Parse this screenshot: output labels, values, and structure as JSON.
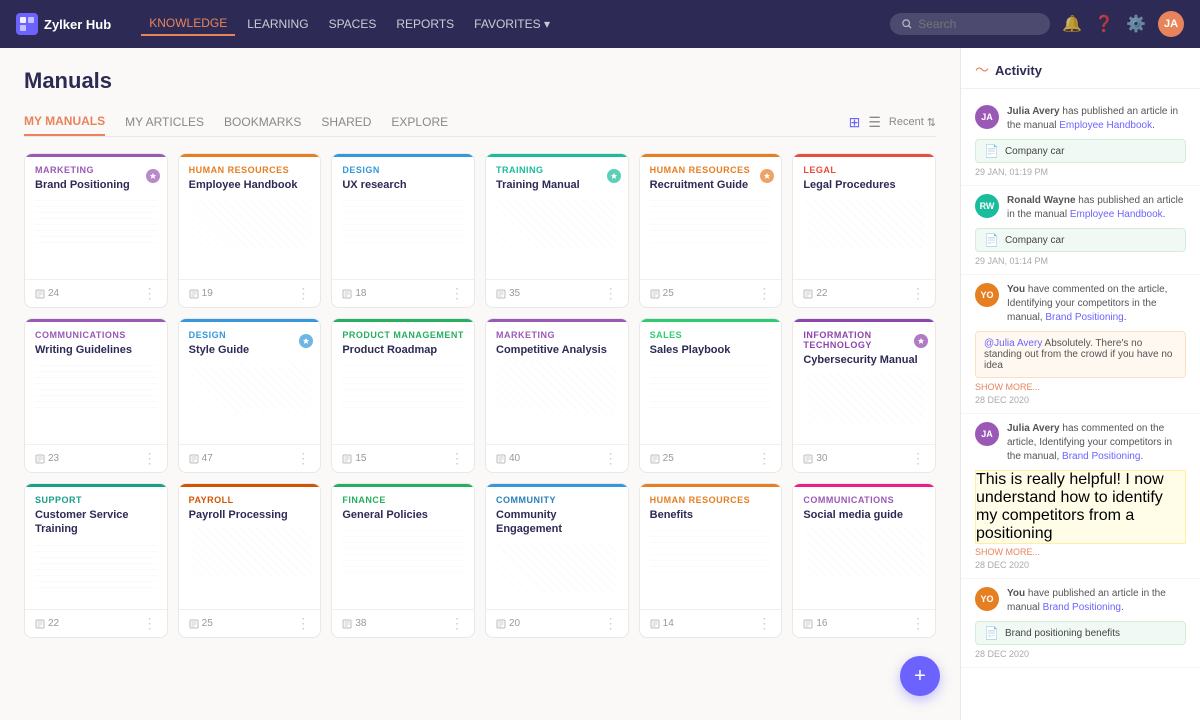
{
  "app": {
    "name": "Zylker Hub",
    "logo_text": "Z"
  },
  "navbar": {
    "items": [
      {
        "label": "KNOWLEDGE",
        "active": true
      },
      {
        "label": "LEARNING",
        "active": false
      },
      {
        "label": "SPACES",
        "active": false
      },
      {
        "label": "REPORTS",
        "active": false
      },
      {
        "label": "FAVORITES ▾",
        "active": false
      }
    ],
    "search_placeholder": "Search",
    "avatar_initials": "JA"
  },
  "page": {
    "title": "Manuals"
  },
  "tabs": [
    {
      "label": "MY MANUALS",
      "active": true
    },
    {
      "label": "MY ARTICLES",
      "active": false
    },
    {
      "label": "BOOKMARKS",
      "active": false
    },
    {
      "label": "SHARED",
      "active": false
    },
    {
      "label": "EXPLORE",
      "active": false
    }
  ],
  "tab_actions": {
    "recent_label": "Recent"
  },
  "cards": [
    {
      "id": 1,
      "category": "MARKETING",
      "cat_class": "cat-marketing",
      "border_class": "border-purple",
      "title": "Brand Positioning",
      "pages": 24,
      "has_badge": true,
      "badge_color": "#9b59b6"
    },
    {
      "id": 2,
      "category": "HUMAN RESOURCES",
      "cat_class": "cat-hr",
      "border_class": "border-orange",
      "title": "Employee Handbook",
      "pages": 19,
      "has_badge": false
    },
    {
      "id": 3,
      "category": "DESIGN",
      "cat_class": "cat-design",
      "border_class": "border-blue",
      "title": "UX research",
      "pages": 18,
      "has_badge": false
    },
    {
      "id": 4,
      "category": "TRAINING",
      "cat_class": "cat-teal",
      "border_class": "border-teal",
      "title": "Training Manual",
      "pages": 35,
      "has_badge": true
    },
    {
      "id": 5,
      "category": "HUMAN RESOURCES",
      "cat_class": "cat-hr",
      "border_class": "border-orange",
      "title": "Recruitment Guide",
      "pages": 25,
      "has_badge": true
    },
    {
      "id": 6,
      "category": "LEGAL",
      "cat_class": "cat-legal",
      "border_class": "border-red",
      "title": "Legal Procedures",
      "pages": 22,
      "has_badge": false
    },
    {
      "id": 7,
      "category": "COMMUNICATIONS",
      "cat_class": "cat-communications",
      "border_class": "border-purple",
      "title": "Writing Guidelines",
      "pages": 23,
      "has_badge": false
    },
    {
      "id": 8,
      "category": "DESIGN",
      "cat_class": "cat-design",
      "border_class": "border-blue",
      "title": "Style Guide",
      "pages": 47,
      "has_badge": true
    },
    {
      "id": 9,
      "category": "PRODUCT MANAGEMENT",
      "cat_class": "cat-product",
      "border_class": "border-green",
      "title": "Product Roadmap",
      "pages": 15,
      "has_badge": false
    },
    {
      "id": 10,
      "category": "MARKETING",
      "cat_class": "cat-marketing",
      "border_class": "border-purple",
      "title": "Competitive Analysis",
      "pages": 40,
      "has_badge": false
    },
    {
      "id": 11,
      "category": "SALES",
      "cat_class": "cat-sales",
      "border_class": "border-darkgreen",
      "title": "Sales Playbook",
      "pages": 25,
      "has_badge": false
    },
    {
      "id": 12,
      "category": "INFORMATION TECHNOLOGY",
      "cat_class": "cat-it",
      "border_class": "border-violet",
      "title": "Cybersecurity Manual",
      "pages": 30,
      "has_badge": true
    },
    {
      "id": 13,
      "category": "SUPPORT",
      "cat_class": "cat-support",
      "border_class": "border-cyan",
      "title": "Customer Service Training",
      "pages": 22,
      "has_badge": false
    },
    {
      "id": 14,
      "category": "PAYROLL",
      "cat_class": "cat-payroll",
      "border_class": "border-darkorange",
      "title": "Payroll Processing",
      "pages": 25,
      "has_badge": false
    },
    {
      "id": 15,
      "category": "FINANCE",
      "cat_class": "cat-finance",
      "border_class": "border-green",
      "title": "General Policies",
      "pages": 38,
      "has_badge": false
    },
    {
      "id": 16,
      "category": "COMMUNITY",
      "cat_class": "cat-community",
      "border_class": "border-blue",
      "title": "Community Engagement",
      "pages": 20,
      "has_badge": false
    },
    {
      "id": 17,
      "category": "HUMAN RESOURCES",
      "cat_class": "cat-hr",
      "border_class": "border-orange",
      "title": "Benefits",
      "pages": 14,
      "has_badge": false
    },
    {
      "id": 18,
      "category": "COMMUNICATIONS",
      "cat_class": "cat-communications",
      "border_class": "border-pink",
      "title": "Social media guide",
      "pages": 16,
      "has_badge": false
    }
  ],
  "activity": {
    "title": "Activity",
    "items": [
      {
        "id": 1,
        "avatar_initials": "JA",
        "avatar_class": "av-purple",
        "text_before": "Julia Avery",
        "action": " has published an article in the manual ",
        "link": "Employee Handbook",
        "card_ref": "Company car",
        "time": "29 JAN, 01:19 PM",
        "card_color": "green"
      },
      {
        "id": 2,
        "avatar_initials": "RW",
        "avatar_class": "av-teal",
        "text_before": "Ronald Wayne",
        "action": " has published an article in the manual ",
        "link": "Employee Handbook",
        "card_ref": "Company car",
        "time": "29 JAN, 01:14 PM",
        "card_color": "green"
      },
      {
        "id": 3,
        "avatar_initials": "YO",
        "avatar_class": "av-orange",
        "text_before": "You",
        "action": " have commented on the article, Identifying your competitors in the manual, ",
        "link": "Brand Positioning",
        "comment": "@Julia Avery Absolutely. There's no standing out from the crowd if you have no idea",
        "show_more": "SHOW MORE...",
        "time": "28 DEC 2020",
        "is_comment": true
      },
      {
        "id": 4,
        "avatar_initials": "JA",
        "avatar_class": "av-purple",
        "text_before": "Julia Avery",
        "action": " has commented on the article, Identifying your competitors in the manual, ",
        "link": "Brand Positioning",
        "comment": "This is really helpful! I now understand how to identify my competitors from a positioning",
        "show_more": "SHOW MORE...",
        "time": "28 DEC 2020",
        "is_comment": true,
        "comment_class": "comment-yellow"
      },
      {
        "id": 5,
        "avatar_initials": "YO",
        "avatar_class": "av-orange",
        "text_before": "You",
        "action": " have published an article in the manual ",
        "link": "Brand Positioning",
        "card_ref": "Brand positioning benefits",
        "time": "28 DEC 2020",
        "card_color": "green"
      }
    ]
  },
  "fab_label": "+"
}
